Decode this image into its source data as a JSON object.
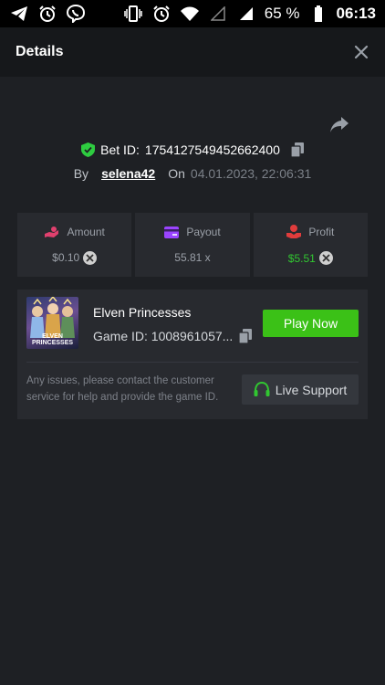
{
  "status_bar": {
    "battery_percent": "65 %",
    "time": "06:13",
    "left_icons": [
      "telegram-icon",
      "alarm-icon",
      "viber-icon"
    ],
    "right_icons": [
      "vibrate-icon",
      "alarm-icon",
      "wifi-icon",
      "signal-empty-icon",
      "signal-icon",
      "battery-icon"
    ]
  },
  "header": {
    "title": "Details"
  },
  "bet": {
    "bet_id_label": "Bet ID:",
    "bet_id": "1754127549452662400",
    "by_label": "By",
    "username": "selena42",
    "on_label": "On",
    "date": "04.01.2023, 22:06:31"
  },
  "stats": [
    {
      "label": "Amount",
      "value": "$0.10",
      "icon": "amount-icon",
      "icon_color": "#e0406e",
      "value_color": "#9ba0a8",
      "coin": true
    },
    {
      "label": "Payout",
      "value": "55.81 x",
      "icon": "card-icon",
      "icon_color": "#9b44ff",
      "value_color": "#9ba0a8",
      "coin": false
    },
    {
      "label": "Profit",
      "value": "$5.51",
      "icon": "profit-icon",
      "icon_color": "#e03c3c",
      "value_color": "#31c631",
      "coin": true
    }
  ],
  "game": {
    "name": "Elven Princesses",
    "game_id": "Game ID: 1008961057...",
    "thumbnail_title": "ELVEN PRINCESSES",
    "play_label": "Play Now"
  },
  "support": {
    "text": "Any issues, please contact the customer service for help and provide the game ID.",
    "button_label": "Live Support"
  },
  "colors": {
    "accent_green": "#3bc117",
    "background": "#1e2024",
    "panel": "#282a2f"
  }
}
